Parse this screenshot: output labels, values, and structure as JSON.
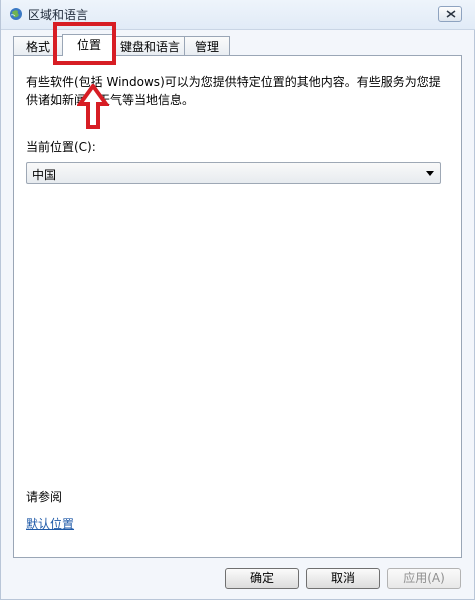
{
  "window": {
    "title": "区域和语言",
    "colors": {
      "annotation": "#d71d24",
      "link": "#1f5aa8"
    }
  },
  "tabs": [
    {
      "label": "格式"
    },
    {
      "label": "位置"
    },
    {
      "label": "键盘和语言"
    },
    {
      "label": "管理"
    }
  ],
  "panel": {
    "description": "有些软件(包括 Windows)可以为您提供特定位置的其他内容。有些服务为您提供诸如新闻和天气等当地信息。",
    "current_location_label": "当前位置(C):",
    "dropdown_value": "中国",
    "see_also_label": "请参阅",
    "default_location_link": "默认位置"
  },
  "buttons": {
    "ok": "确定",
    "cancel": "取消",
    "apply": "应用(A)"
  },
  "icons": {
    "title_icon": "globe-icon",
    "close_icon": "close-icon",
    "dropdown_icon": "chevron-down-icon"
  }
}
